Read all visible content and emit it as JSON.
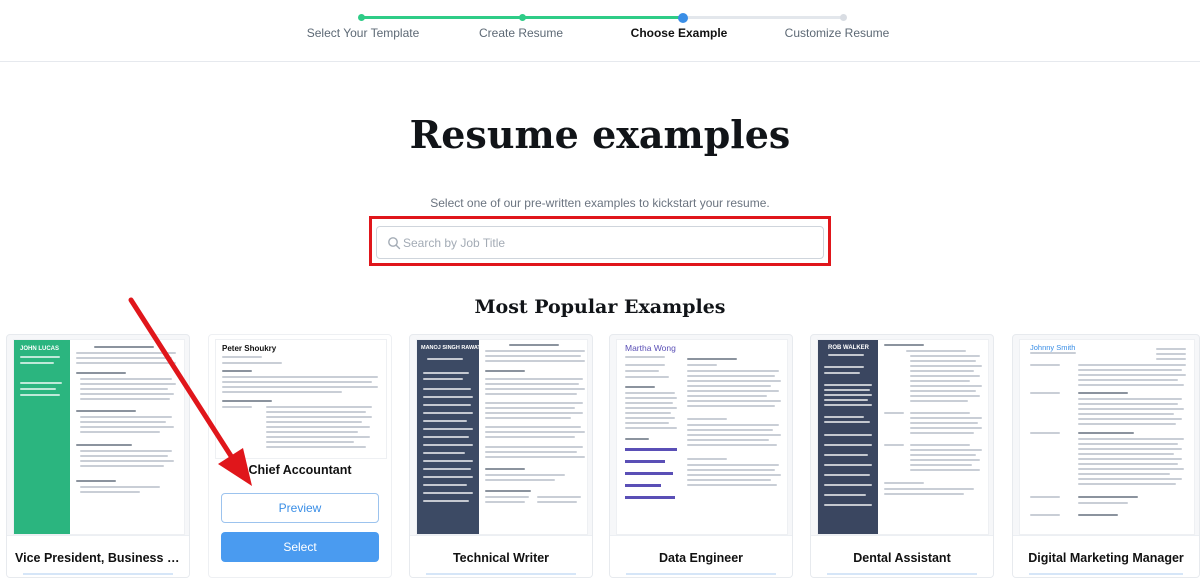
{
  "stepper": {
    "steps": [
      {
        "label": "Select Your Template",
        "state": "done"
      },
      {
        "label": "Create Resume",
        "state": "done"
      },
      {
        "label": "Choose Example",
        "state": "current"
      },
      {
        "label": "Customize Resume",
        "state": "todo"
      }
    ]
  },
  "header": {
    "title": "Resume examples",
    "subtitle": "Select one of our pre-written examples to kickstart your resume."
  },
  "search": {
    "placeholder": "Search by Job Title",
    "value": ""
  },
  "popular": {
    "title": "Most Popular Examples",
    "cards": [
      {
        "label": "Vice President, Business D...",
        "thumb_name": "JOHN LUCAS",
        "accent": "#2bb57f"
      },
      {
        "label": "Chief Accountant",
        "thumb_name": "Peter Shoukry",
        "accent": "#ffffff",
        "preview": "Preview",
        "select": "Select"
      },
      {
        "label": "Technical Writer",
        "thumb_name": "MANOJ SINGH RAWAT",
        "accent": "#3c4a64"
      },
      {
        "label": "Data Engineer",
        "thumb_name": "Martha Wong",
        "accent": "#5a4fb6"
      },
      {
        "label": "Dental Assistant",
        "thumb_name": "ROB WALKER",
        "accent": "#3a4660"
      },
      {
        "label": "Digital Marketing Manager",
        "thumb_name": "Johnny Smith",
        "accent": "#3a8ee6"
      }
    ]
  },
  "colors": {
    "step_done": "#2ecc87",
    "step_current": "#3a8ee6",
    "annotation": "#e0161b",
    "primary_button": "#4a9bf0"
  }
}
